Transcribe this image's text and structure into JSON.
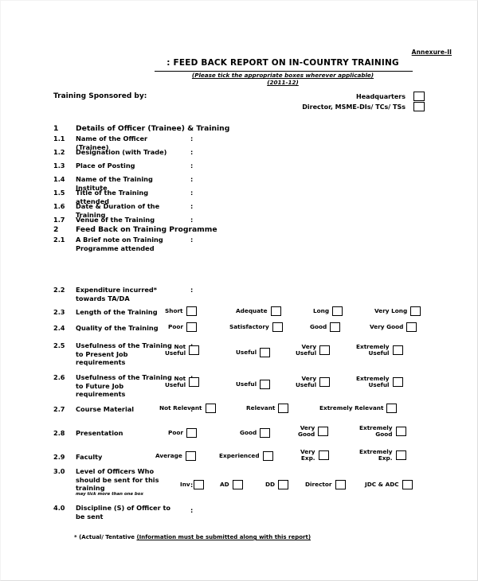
{
  "header": {
    "annexure": "Annexure-II",
    "title": ": FEED BACK REPORT ON IN-COUNTRY TRAINING",
    "subtitle": "(Please tick the appropriate boxes wherever applicable)",
    "year": "(2011-12)"
  },
  "sponsor": {
    "label": "Training Sponsored by:",
    "options": [
      {
        "label": "Headquarters",
        "checked": false
      },
      {
        "label": "Director, MSME-DIs/ TCs/ TSs",
        "checked": false
      }
    ]
  },
  "sections": [
    {
      "num": "1",
      "title": "Details of Officer (Trainee) & Training"
    },
    {
      "num": "2",
      "title": "Feed Back on Training Programme"
    }
  ],
  "section1_rows": [
    {
      "num": "1.1",
      "label": "Name of the Officer (Trainee)",
      "colon": ":",
      "value": ""
    },
    {
      "num": "1.2",
      "label": "Designation (with Trade)",
      "colon": ":",
      "value": ""
    },
    {
      "num": "1.3",
      "label": "Place of Posting",
      "colon": ":",
      "value": ""
    },
    {
      "num": "1.4",
      "label": "Name of the Training Institute",
      "colon": ":",
      "value": ""
    },
    {
      "num": "1.5",
      "label": "Title of the Training attended",
      "colon": ":",
      "value": ""
    },
    {
      "num": "1.6",
      "label": "Date & Duration of the Training",
      "colon": ":",
      "value": ""
    },
    {
      "num": "1.7",
      "label": "Venue of the Training",
      "colon": ":",
      "value": ""
    }
  ],
  "section2_rows": [
    {
      "num": "2.1",
      "label": "A Brief note on Training Programme attended",
      "colon": ":",
      "options": []
    },
    {
      "num": "2.2",
      "label": "Expenditure incurred* towards TA/DA",
      "colon": ":",
      "options": []
    },
    {
      "num": "2.3",
      "label": "Length of the Training",
      "colon": ":",
      "options": [
        {
          "label": "Short",
          "checked": false
        },
        {
          "label": "Adequate",
          "checked": false
        },
        {
          "label": "Long",
          "checked": false
        },
        {
          "label": "Very Long",
          "checked": false
        }
      ]
    },
    {
      "num": "2.4",
      "label": "Quality of the Training",
      "colon": ":",
      "options": [
        {
          "label": "Poor",
          "checked": false
        },
        {
          "label": "Satisfactory",
          "checked": false
        },
        {
          "label": "Good",
          "checked": false
        },
        {
          "label": "Very Good",
          "checked": false
        }
      ]
    },
    {
      "num": "2.5",
      "label": "Usefulness of the Training to Present Job requirements",
      "colon": ":",
      "options": [
        {
          "label": "Not\nUseful",
          "checked": false
        },
        {
          "label": "Useful",
          "checked": false
        },
        {
          "label": "Very\nUseful",
          "checked": false
        },
        {
          "label": "Extremely\nUseful",
          "checked": false
        }
      ]
    },
    {
      "num": "2.6",
      "label": "Usefulness of the Training to Future Job requirements",
      "colon": ":",
      "options": [
        {
          "label": "Not\nUseful",
          "checked": false
        },
        {
          "label": "Useful",
          "checked": false
        },
        {
          "label": "Very\nUseful",
          "checked": false
        },
        {
          "label": "Extremely\nUseful",
          "checked": false
        }
      ]
    },
    {
      "num": "2.7",
      "label": "Course Material",
      "colon": ":",
      "options": [
        {
          "label": "Not Relevant",
          "checked": false
        },
        {
          "label": "Relevant",
          "checked": false
        },
        {
          "label": "Extremely Relevant",
          "checked": false
        }
      ]
    },
    {
      "num": "2.8",
      "label": "Presentation",
      "colon": ":",
      "options": [
        {
          "label": "Poor",
          "checked": false
        },
        {
          "label": "Good",
          "checked": false
        },
        {
          "label": "Very\nGood",
          "checked": false
        },
        {
          "label": "Extremely\nGood",
          "checked": false
        }
      ]
    },
    {
      "num": "2.9",
      "label": "Faculty",
      "colon": ":",
      "options": [
        {
          "label": "Average",
          "checked": false
        },
        {
          "label": "Experienced",
          "checked": false
        },
        {
          "label": "Very\nExp.",
          "checked": false
        },
        {
          "label": "Extremely\nExp.",
          "checked": false
        }
      ]
    },
    {
      "num": "3.0",
      "label": "Level of Officers Who should be sent for this training",
      "subnote": "may tick more than one box",
      "colon": ":",
      "options": [
        {
          "label": "Inv",
          "checked": false
        },
        {
          "label": "AD",
          "checked": false
        },
        {
          "label": "DD",
          "checked": false
        },
        {
          "label": "Director",
          "checked": false
        },
        {
          "label": "JDC & ADC",
          "checked": false
        }
      ]
    },
    {
      "num": "4.0",
      "label": "Discipline (S) of Officer to be sent",
      "colon": ":",
      "options": []
    }
  ],
  "footer": {
    "prefix": "* (Actual/ Tentative ",
    "emphasis": "(Information must be submitted along with this report)",
    "suffix": ""
  }
}
